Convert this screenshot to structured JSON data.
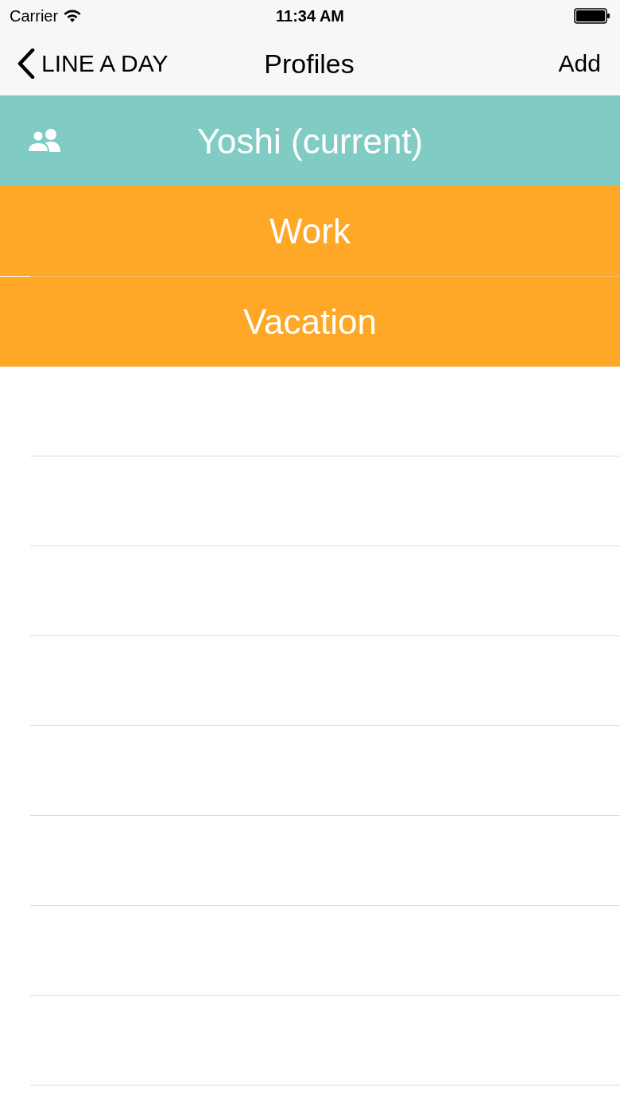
{
  "status_bar": {
    "carrier": "Carrier",
    "time": "11:34 AM"
  },
  "nav_bar": {
    "back": "LINE A DAY",
    "title": "Profiles",
    "action": "Add"
  },
  "profiles": [
    {
      "name": "Yoshi (current)",
      "current": true
    },
    {
      "name": "Work",
      "current": false
    },
    {
      "name": "Vacation",
      "current": false
    }
  ]
}
